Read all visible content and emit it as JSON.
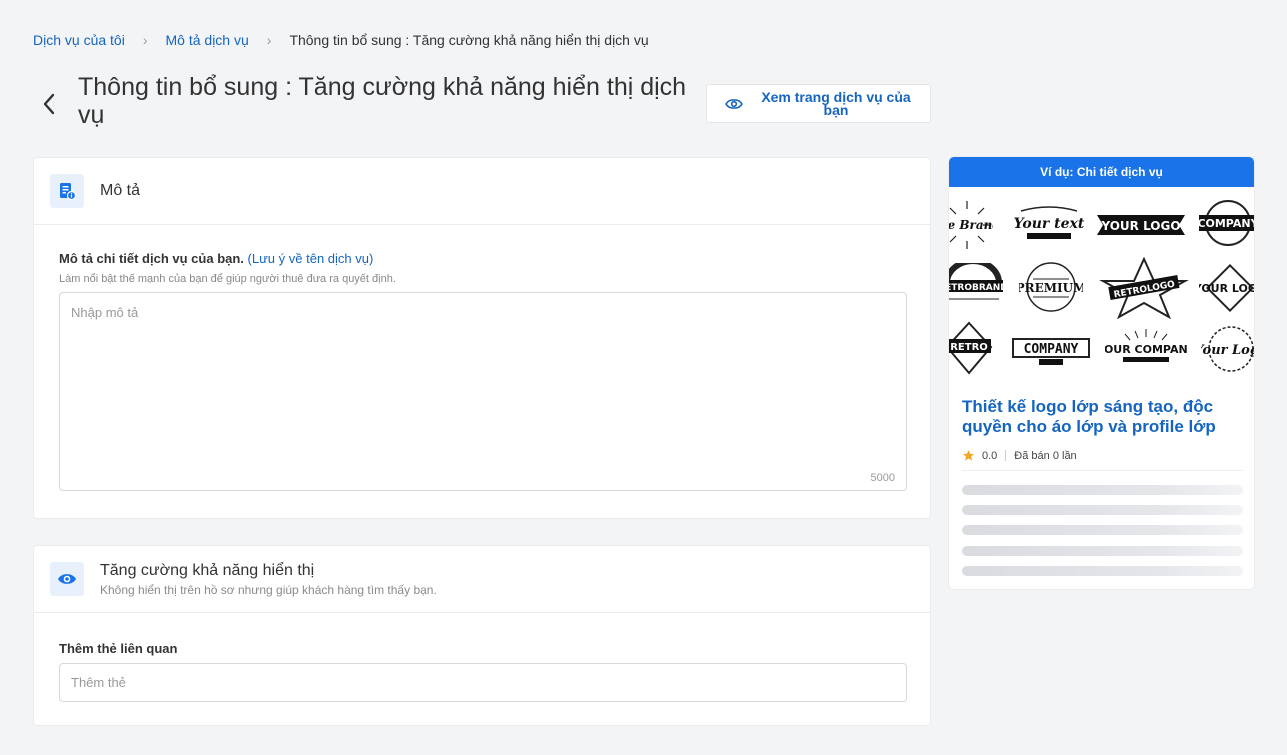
{
  "breadcrumb": {
    "item1": "Dịch vụ của tôi",
    "item2": "Mô tả dịch vụ",
    "current": "Thông tin bổ sung : Tăng cường khả năng hiển thị dịch vụ"
  },
  "page": {
    "title": "Thông tin bổ sung : Tăng cường khả năng hiển thị dịch vụ",
    "view_button": "Xem trang dịch vụ của bạn"
  },
  "description_card": {
    "title": "Mô tả",
    "label": "Mô tả chi tiết dịch vụ của bạn.",
    "label_link": "(Lưu ý về tên dịch vụ)",
    "hint": "Làm nổi bật thế mạnh của bạn để giúp người thuê đưa ra quyết định.",
    "placeholder": "Nhập mô tả",
    "char_limit": "5000"
  },
  "visibility_card": {
    "title": "Tăng cường khả năng hiển thị",
    "subtitle": "Không hiển thị trên hồ sơ nhưng giúp khách hàng tìm thấy bạn.",
    "tags_label": "Thêm thẻ liên quan",
    "tags_placeholder": "Thêm thẻ"
  },
  "example": {
    "header": "Ví dụ: Chi tiết dịch vụ",
    "logos": [
      "the Brand",
      "Your text",
      "YOUR LOGO",
      "COMPANY",
      "RETROBRAND",
      "PREMIUM",
      "RETROLOGO",
      "YOUR LOGO",
      "RETRO",
      "COMPANY",
      "YOUR COMPANY",
      "Your Logo"
    ],
    "service_title": "Thiết kế logo lớp sáng tạo, độc quyền cho áo lớp và profile lớp",
    "rating": "0.0",
    "sold": "Đã bán 0 lần"
  },
  "colors": {
    "accent": "#1565c0",
    "header_blue": "#1a73e8",
    "star": "#f5a623"
  }
}
